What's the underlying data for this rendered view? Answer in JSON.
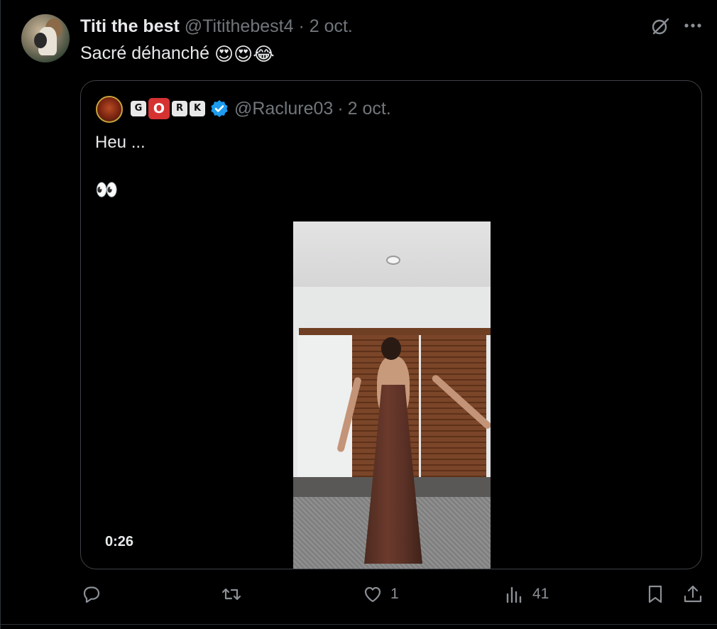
{
  "tweet": {
    "display_name": "Titi the best",
    "handle": "@Titithebest4",
    "separator": "·",
    "date": "2 oct.",
    "text": "Sacré déhanché",
    "emojis": "😍😍😂"
  },
  "quote": {
    "name_letters": [
      "G",
      "O",
      "R",
      "K"
    ],
    "handle": "@Raclure03",
    "separator": "·",
    "date": "2 oct.",
    "text_line1": "Heu ...",
    "text_line2": "👀",
    "video_duration": "0:26"
  },
  "actions": {
    "reply_count": "",
    "retweet_count": "",
    "like_count": "1",
    "views_count": "41"
  },
  "colors": {
    "background": "#000000",
    "text": "#e7e9ea",
    "muted": "#71767b",
    "verified": "#1d9bf0",
    "card_border": "#3e4144"
  }
}
